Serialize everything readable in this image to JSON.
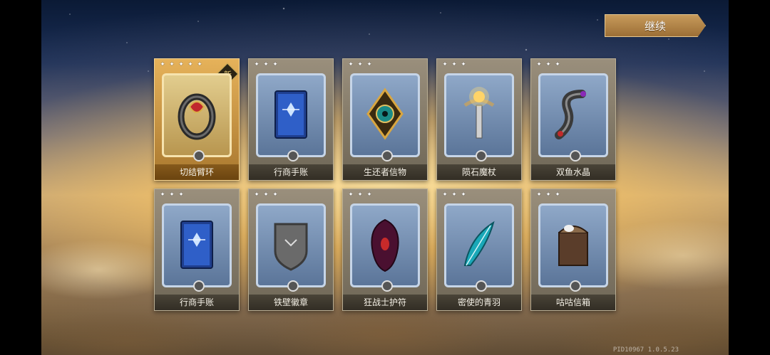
{
  "header": {
    "continue_label": "继续"
  },
  "cards": [
    {
      "name": "切结臂环",
      "stars": 5,
      "is_new": true,
      "new_label": "新",
      "featured": true,
      "icon": "bracelet-icon"
    },
    {
      "name": "行商手账",
      "stars": 3,
      "is_new": false,
      "featured": false,
      "icon": "book-icon"
    },
    {
      "name": "生还者信物",
      "stars": 3,
      "is_new": false,
      "featured": false,
      "icon": "eye-amulet-icon"
    },
    {
      "name": "陨石魔杖",
      "stars": 3,
      "is_new": false,
      "featured": false,
      "icon": "scepter-icon"
    },
    {
      "name": "双鱼水晶",
      "stars": 3,
      "is_new": false,
      "featured": false,
      "icon": "serpent-crystal-icon"
    },
    {
      "name": "行商手账",
      "stars": 3,
      "is_new": false,
      "featured": false,
      "icon": "book-icon"
    },
    {
      "name": "铁壁徽章",
      "stars": 3,
      "is_new": false,
      "featured": false,
      "icon": "shield-badge-icon"
    },
    {
      "name": "狂战士护符",
      "stars": 3,
      "is_new": false,
      "featured": false,
      "icon": "hooded-charm-icon"
    },
    {
      "name": "密使的青羽",
      "stars": 3,
      "is_new": false,
      "featured": false,
      "icon": "feather-icon"
    },
    {
      "name": "咕咕信箱",
      "stars": 3,
      "is_new": false,
      "featured": false,
      "icon": "mailbox-icon"
    }
  ],
  "footer": {
    "version_text": "PID10967 1.0.5.23"
  },
  "colors": {
    "featured_frame": "#e6b25a",
    "normal_frame": "#8fa8c8",
    "button": "#b3844a"
  }
}
